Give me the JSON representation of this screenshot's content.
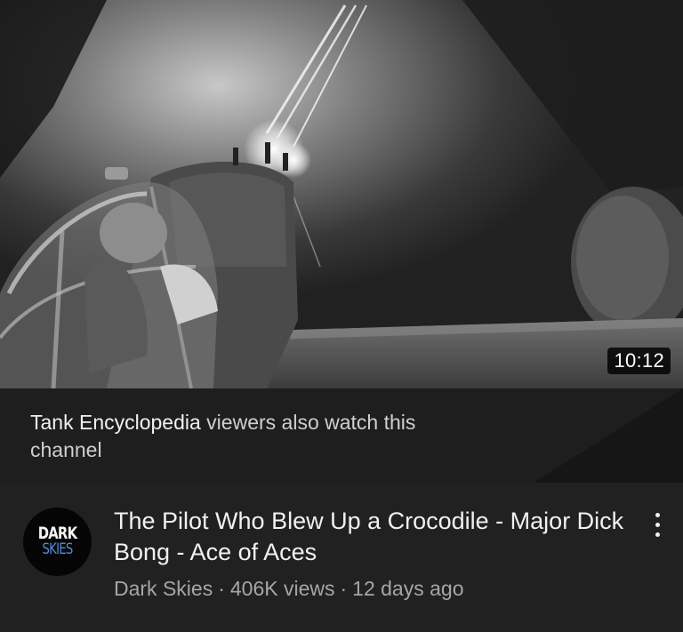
{
  "video": {
    "duration": "10:12",
    "title": "The Pilot Who Blew Up a Crocodile - Major Dick Bong - Ace of Aces",
    "channel": "Dark Skies",
    "views": "406K views",
    "age": "12 days ago",
    "separator": "·"
  },
  "avatar": {
    "line1": "DARK",
    "line2": "SKIES"
  },
  "also_watch": {
    "channel": "Tank Encyclopedia",
    "text": " viewers also watch this channel"
  },
  "icons": {
    "menu": "kebab-menu-icon"
  },
  "colors": {
    "background": "#0f0f0f",
    "banner": "#1e1e1e",
    "meta_background": "#212121",
    "secondary_text": "#a6a6a6",
    "avatar_accent": "#4a8fe0"
  }
}
